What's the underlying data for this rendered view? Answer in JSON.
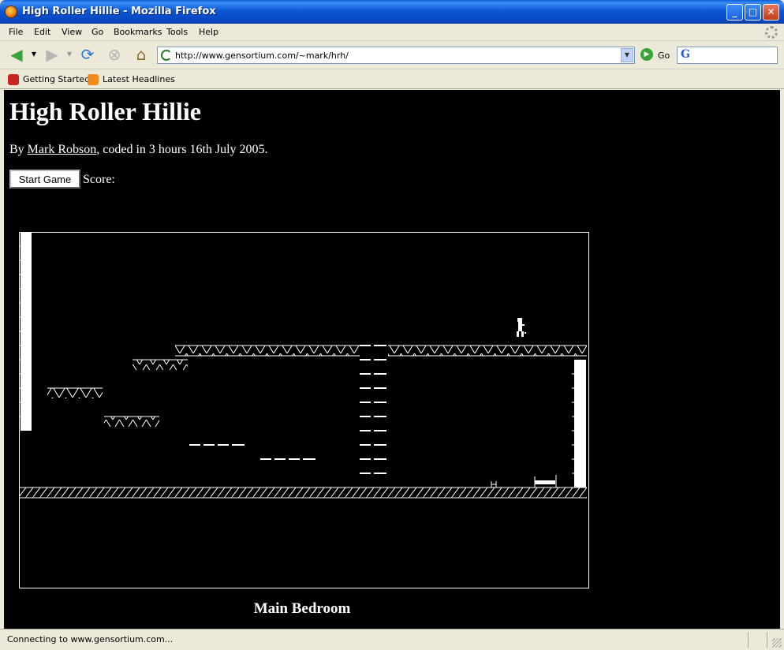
{
  "window": {
    "title": "High Roller Hillie - Mozilla Firefox",
    "controls": {
      "minimize": "_",
      "maximize": "□",
      "close": "✕"
    }
  },
  "menu": [
    "File",
    "Edit",
    "View",
    "Go",
    "Bookmarks",
    "Tools",
    "Help"
  ],
  "nav": {
    "url": "http://www.gensortium.com/~mark/hrh/",
    "go_label": "Go"
  },
  "bookmarks": [
    {
      "label": "Getting Started",
      "icon": "firefox-red-icon"
    },
    {
      "label": "Latest Headlines",
      "icon": "rss-feed-icon"
    }
  ],
  "page": {
    "heading": "High Roller Hillie",
    "byline_prefix": "By ",
    "author_link": "Mark Robson",
    "byline_suffix": ", coded in 3 hours 16th July 2005.",
    "start_button": "Start Game",
    "score_label": "Score:",
    "room_name": "Main Bedroom"
  },
  "status": {
    "text": "Connecting to www.gensortium.com..."
  }
}
